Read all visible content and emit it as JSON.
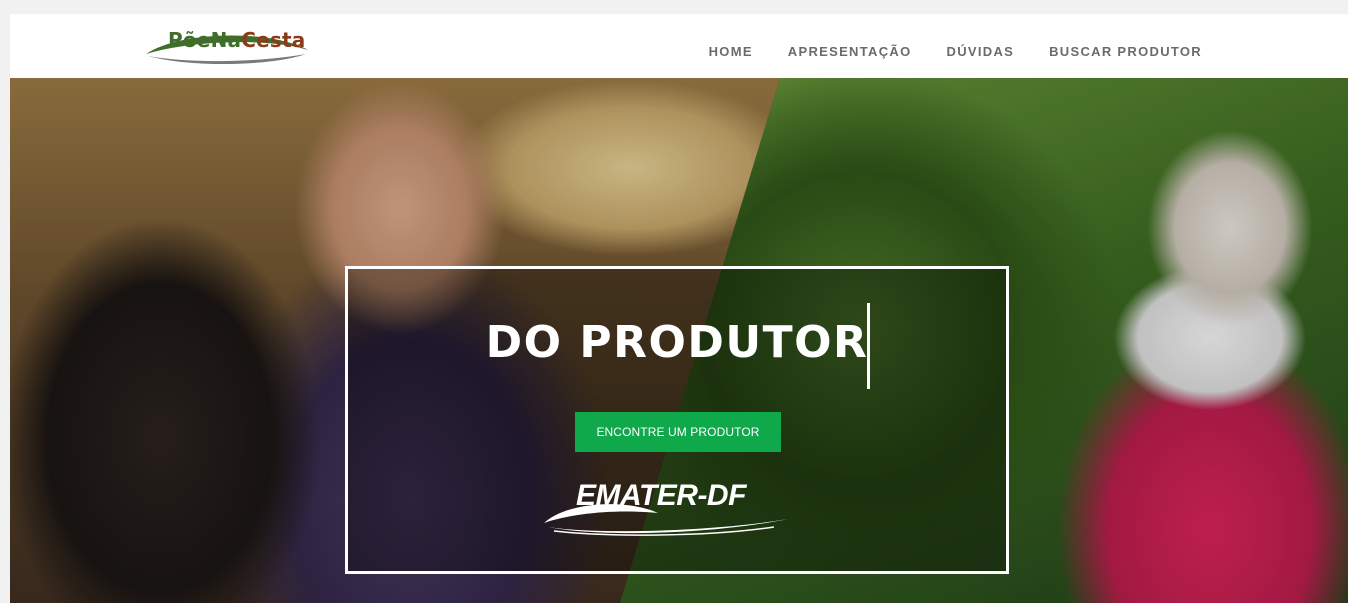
{
  "header": {
    "logo": {
      "part1": "PõeNa",
      "part2": "Cesta"
    },
    "nav": [
      "HOME",
      "APRESENTAÇÃO",
      "DÚVIDAS",
      "BUSCAR PRODUTOR"
    ]
  },
  "hero": {
    "headline": "DO PRODUTOR",
    "cta_label": "ENCONTRE UM PRODUTOR",
    "partner_logo": "EMATER-DF"
  },
  "colors": {
    "cta_green": "#0fa84b",
    "logo_green": "#3f6e2a",
    "logo_brown": "#8c3a1a",
    "nav_text": "#6b6b6b"
  }
}
